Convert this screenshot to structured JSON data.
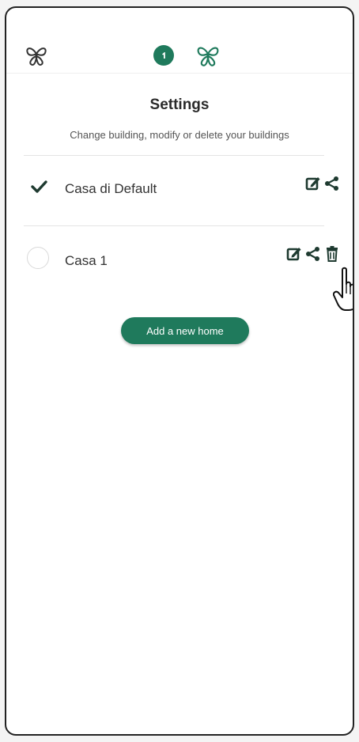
{
  "header": {
    "logo_left_icon": "butterfly-logo-icon",
    "step_number": "1",
    "logo_center_icon": "butterfly-logo-icon"
  },
  "page": {
    "title": "Settings",
    "subtitle": "Change building, modify or delete your buildings"
  },
  "homes": [
    {
      "name": "Casa di Default",
      "selected": true,
      "actions": [
        "edit-icon",
        "share-icon"
      ]
    },
    {
      "name": "Casa 1",
      "selected": false,
      "actions": [
        "edit-icon",
        "share-icon",
        "trash-icon"
      ]
    }
  ],
  "add_home_label": "Add a new home",
  "colors": {
    "accent": "#1f7a5c",
    "text": "#333333"
  }
}
